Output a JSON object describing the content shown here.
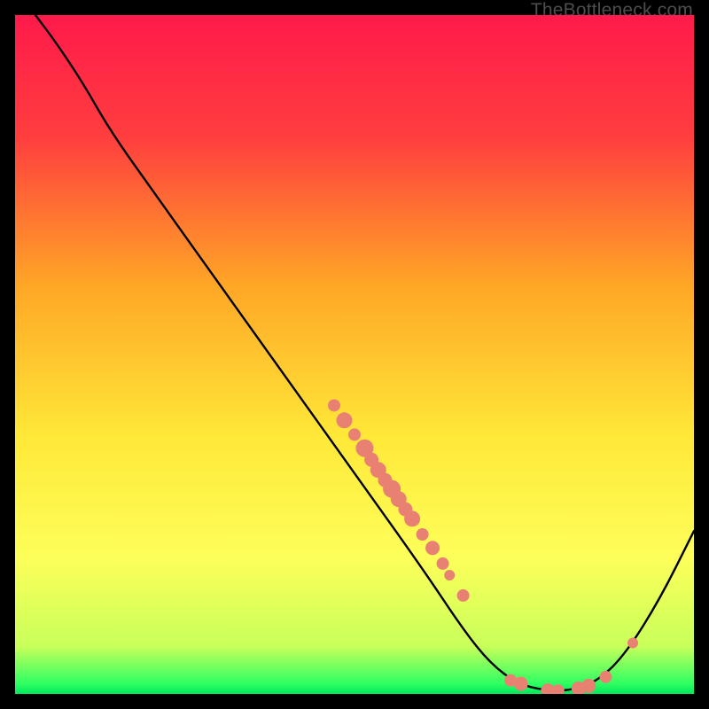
{
  "watermark": "TheBottleneck.com",
  "chart_data": {
    "type": "line",
    "title": "",
    "xlabel": "",
    "ylabel": "",
    "xlim": [
      0,
      100
    ],
    "ylim": [
      0,
      100
    ],
    "gradient_stops": [
      {
        "offset": 0.0,
        "color": "#ff1a4b"
      },
      {
        "offset": 0.18,
        "color": "#ff3e3e"
      },
      {
        "offset": 0.4,
        "color": "#ffa726"
      },
      {
        "offset": 0.62,
        "color": "#ffe838"
      },
      {
        "offset": 0.8,
        "color": "#fdff5a"
      },
      {
        "offset": 0.93,
        "color": "#c8ff5a"
      },
      {
        "offset": 0.985,
        "color": "#2eff62"
      },
      {
        "offset": 1.0,
        "color": "#00e85e"
      }
    ],
    "curve": [
      {
        "x": 3.0,
        "y": 100.0
      },
      {
        "x": 6.0,
        "y": 96.0
      },
      {
        "x": 10.0,
        "y": 90.0
      },
      {
        "x": 14.0,
        "y": 83.0
      },
      {
        "x": 20.0,
        "y": 74.5
      },
      {
        "x": 30.0,
        "y": 60.5
      },
      {
        "x": 40.0,
        "y": 46.5
      },
      {
        "x": 50.0,
        "y": 32.5
      },
      {
        "x": 60.0,
        "y": 18.5
      },
      {
        "x": 66.0,
        "y": 9.5
      },
      {
        "x": 70.0,
        "y": 4.5
      },
      {
        "x": 74.0,
        "y": 1.5
      },
      {
        "x": 78.0,
        "y": 0.5
      },
      {
        "x": 82.0,
        "y": 0.5
      },
      {
        "x": 86.0,
        "y": 2.0
      },
      {
        "x": 90.0,
        "y": 6.0
      },
      {
        "x": 95.0,
        "y": 14.0
      },
      {
        "x": 100.0,
        "y": 24.0
      }
    ],
    "dots": [
      {
        "x": 47.0,
        "y": 42.5,
        "r": 7
      },
      {
        "x": 48.5,
        "y": 40.3,
        "r": 9
      },
      {
        "x": 50.0,
        "y": 38.2,
        "r": 7
      },
      {
        "x": 51.5,
        "y": 36.2,
        "r": 10
      },
      {
        "x": 52.5,
        "y": 34.5,
        "r": 8
      },
      {
        "x": 53.5,
        "y": 33.0,
        "r": 9
      },
      {
        "x": 54.5,
        "y": 31.5,
        "r": 8
      },
      {
        "x": 55.5,
        "y": 30.2,
        "r": 10
      },
      {
        "x": 56.5,
        "y": 28.7,
        "r": 9
      },
      {
        "x": 57.5,
        "y": 27.2,
        "r": 8
      },
      {
        "x": 58.5,
        "y": 25.8,
        "r": 9
      },
      {
        "x": 60.0,
        "y": 23.5,
        "r": 7
      },
      {
        "x": 61.5,
        "y": 21.5,
        "r": 8
      },
      {
        "x": 63.0,
        "y": 19.2,
        "r": 7
      },
      {
        "x": 64.0,
        "y": 17.5,
        "r": 6
      },
      {
        "x": 66.0,
        "y": 14.5,
        "r": 7
      },
      {
        "x": 73.0,
        "y": 2.0,
        "r": 7
      },
      {
        "x": 74.5,
        "y": 1.5,
        "r": 8
      },
      {
        "x": 78.5,
        "y": 0.5,
        "r": 8
      },
      {
        "x": 80.0,
        "y": 0.5,
        "r": 7
      },
      {
        "x": 83.0,
        "y": 0.8,
        "r": 8
      },
      {
        "x": 84.5,
        "y": 1.2,
        "r": 8
      },
      {
        "x": 87.0,
        "y": 2.5,
        "r": 7
      },
      {
        "x": 91.0,
        "y": 7.5,
        "r": 6
      }
    ],
    "dot_color": "#e98173"
  }
}
